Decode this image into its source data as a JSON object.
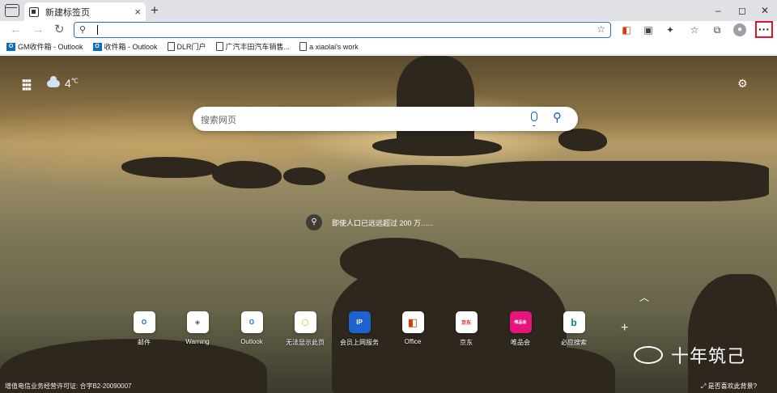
{
  "tab": {
    "title": "新建标签页",
    "close": "×",
    "new": "+"
  },
  "window": {
    "minimize": "–",
    "maximize": "◻",
    "close": "✕"
  },
  "nav": {
    "back": "←",
    "forward": "→",
    "refresh": "↻"
  },
  "address": {
    "value": "",
    "search_glyph": "⚲",
    "fav_glyph": "☆"
  },
  "toolbar": {
    "more": "···"
  },
  "bookmarks": [
    {
      "label": "GM收件箱 - Outlook",
      "icon": "outlook-icon"
    },
    {
      "label": "收件箱 - Outlook",
      "icon": "outlook-icon"
    },
    {
      "label": "DLR门户",
      "icon": "page-icon"
    },
    {
      "label": "广汽丰田汽车销售...",
      "icon": "page-icon"
    },
    {
      "label": "a xiaolai's work",
      "icon": "page-icon"
    }
  ],
  "weather": {
    "temp": "4",
    "unit": "℃"
  },
  "search": {
    "placeholder": "搜索网页"
  },
  "caption": "即使人口已远远超过 200 万......",
  "quick_links": [
    {
      "label": "邮件",
      "glyph": "O",
      "color": "#0f6cbd"
    },
    {
      "label": "Warning",
      "glyph": "◈",
      "color": "#555555"
    },
    {
      "label": "Outlook",
      "glyph": "O",
      "color": "#0f6cbd"
    },
    {
      "label": "无法显示此页",
      "glyph": "◯",
      "color": "#d6a300"
    },
    {
      "label": "会员上网服务",
      "glyph": "IP",
      "color": "#1e62d0"
    },
    {
      "label": "Office",
      "glyph": "◧",
      "color": "#d83b01"
    },
    {
      "label": "京东",
      "glyph": "京东",
      "color": "#e1251b"
    },
    {
      "label": "唯品会",
      "glyph": "唯品会",
      "color": "#e7157b"
    },
    {
      "label": "必应搜索",
      "glyph": "b",
      "color": "#008373"
    }
  ],
  "watermark": "十年筑己",
  "footer": "增值电信业务经营许可证: 合字B2-20090007",
  "bg_question": "是否喜欢此背景?"
}
